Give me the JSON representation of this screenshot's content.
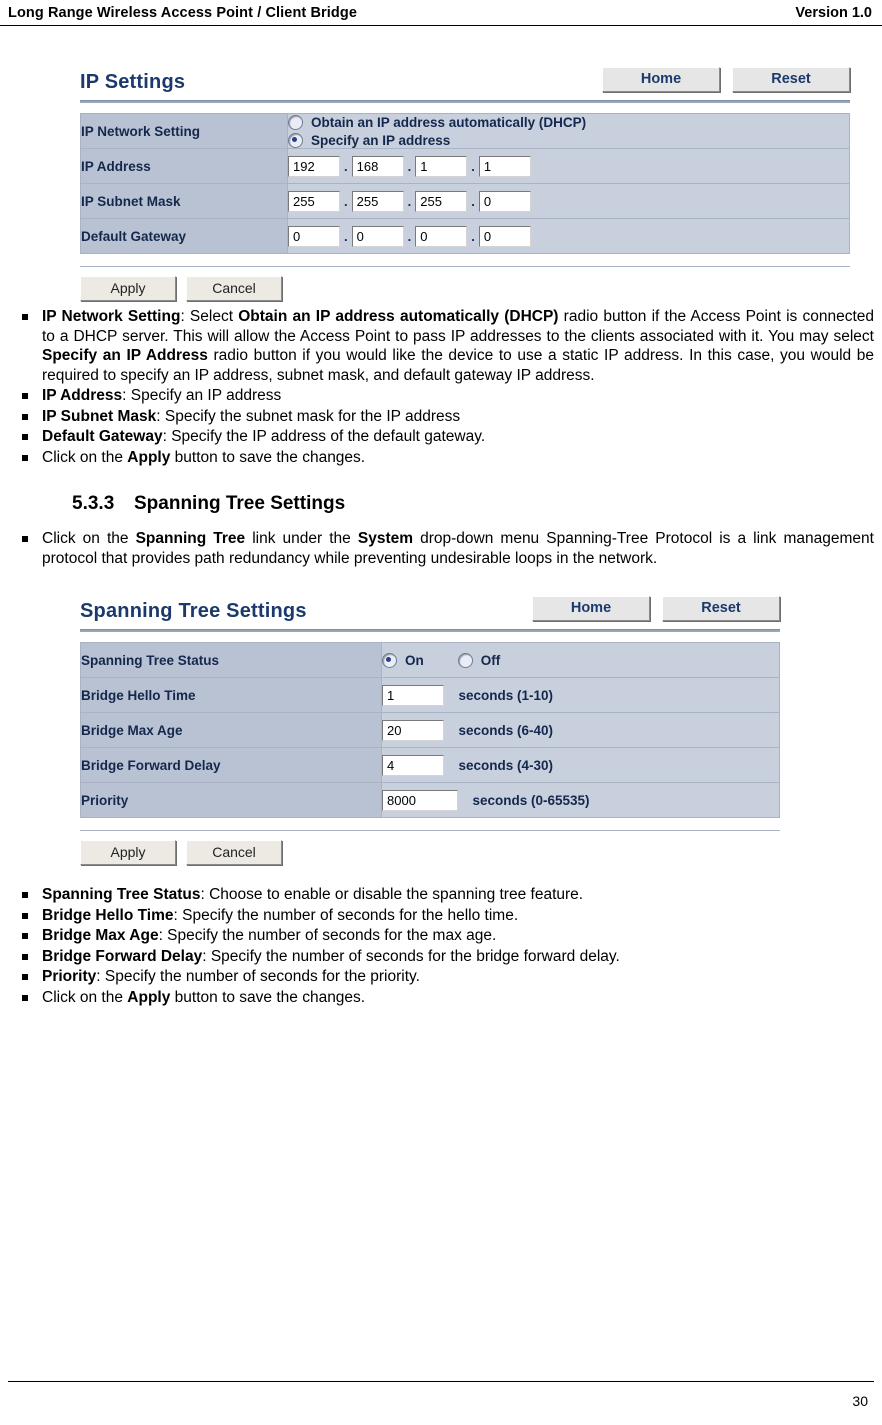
{
  "header": {
    "left": "Long Range Wireless Access Point / Client Bridge",
    "right": "Version 1.0"
  },
  "ip_settings_panel": {
    "title": "IP Settings",
    "home_button": "Home",
    "reset_button": "Reset",
    "rows": [
      {
        "label": "IP Network Setting",
        "type": "radio",
        "options": [
          {
            "label": "Obtain an IP address automatically (DHCP)",
            "selected": false
          },
          {
            "label": "Specify an IP address",
            "selected": true
          }
        ]
      },
      {
        "label": "IP Address",
        "type": "ip",
        "octets": [
          "192",
          "168",
          "1",
          "1"
        ]
      },
      {
        "label": "IP Subnet Mask",
        "type": "ip",
        "octets": [
          "255",
          "255",
          "255",
          "0"
        ]
      },
      {
        "label": "Default Gateway",
        "type": "ip",
        "octets": [
          "0",
          "0",
          "0",
          "0"
        ]
      }
    ],
    "apply_button": "Apply",
    "cancel_button": "Cancel"
  },
  "ip_bullets": [
    {
      "parts": [
        {
          "t": "IP Network Setting",
          "b": true
        },
        {
          "t": ": Select ",
          "b": false
        },
        {
          "t": "Obtain an IP address automatically (DHCP)",
          "b": true
        },
        {
          "t": " radio button if the Access Point is connected to a DHCP server. This will allow the Access Point to pass IP addresses to the clients associated with it. You may select ",
          "b": false
        },
        {
          "t": "Specify an IP Address",
          "b": true
        },
        {
          "t": " radio button if you would like the device to use a static IP address. In this case, you would be required to specify an IP address, subnet mask, and default gateway IP address.",
          "b": false
        }
      ]
    },
    {
      "parts": [
        {
          "t": "IP Address",
          "b": true
        },
        {
          "t": ": Specify an IP address",
          "b": false
        }
      ]
    },
    {
      "parts": [
        {
          "t": "IP Subnet Mask",
          "b": true
        },
        {
          "t": ": Specify the subnet mask for the IP address",
          "b": false
        }
      ]
    },
    {
      "parts": [
        {
          "t": "Default Gateway",
          "b": true
        },
        {
          "t": ": Specify the IP address of the default gateway.",
          "b": false
        }
      ]
    },
    {
      "parts": [
        {
          "t": "Click on the ",
          "b": false
        },
        {
          "t": "Apply",
          "b": true
        },
        {
          "t": " button to save the changes.",
          "b": false
        }
      ]
    }
  ],
  "section": {
    "number": "5.3.3",
    "title": "Spanning Tree Settings"
  },
  "section_bullets": [
    {
      "parts": [
        {
          "t": "Click on the ",
          "b": false
        },
        {
          "t": "Spanning Tree",
          "b": true
        },
        {
          "t": " link under the ",
          "b": false
        },
        {
          "t": "System",
          "b": true
        },
        {
          "t": " drop-down menu Spanning-Tree Protocol is a link management protocol that provides path redundancy while preventing undesirable loops in the network.",
          "b": false
        }
      ]
    }
  ],
  "spanning_tree_panel": {
    "title": "Spanning Tree Settings",
    "home_button": "Home",
    "reset_button": "Reset",
    "rows": [
      {
        "label": "Spanning Tree Status",
        "type": "radio",
        "options": [
          {
            "label": "On",
            "selected": true
          },
          {
            "label": "Off",
            "selected": false
          }
        ]
      },
      {
        "label": "Bridge Hello Time",
        "type": "text",
        "value": "1",
        "unit": "seconds (1-10)"
      },
      {
        "label": "Bridge Max Age",
        "type": "text",
        "value": "20",
        "unit": "seconds (6-40)"
      },
      {
        "label": "Bridge Forward Delay",
        "type": "text",
        "value": "4",
        "unit": "seconds (4-30)"
      },
      {
        "label": "Priority",
        "type": "text",
        "value": "8000",
        "unit": "seconds (0-65535)"
      }
    ],
    "apply_button": "Apply",
    "cancel_button": "Cancel"
  },
  "st_bullets": [
    {
      "parts": [
        {
          "t": "Spanning Tree Status",
          "b": true
        },
        {
          "t": ": Choose to enable or disable the spanning tree feature.",
          "b": false
        }
      ]
    },
    {
      "parts": [
        {
          "t": "Bridge Hello Time",
          "b": true
        },
        {
          "t": ": Specify the number of seconds for the hello time.",
          "b": false
        }
      ]
    },
    {
      "parts": [
        {
          "t": "Bridge Max Age",
          "b": true
        },
        {
          "t": ": Specify the number of seconds for the max age.",
          "b": false
        }
      ]
    },
    {
      "parts": [
        {
          "t": "Bridge Forward Delay",
          "b": true
        },
        {
          "t": ": Specify the number of seconds for the bridge forward delay.",
          "b": false
        }
      ]
    },
    {
      "parts": [
        {
          "t": "Priority",
          "b": true
        },
        {
          "t": ": Specify the number of seconds for the priority.",
          "b": false
        }
      ]
    },
    {
      "parts": [
        {
          "t": "Click on the ",
          "b": false
        },
        {
          "t": "Apply",
          "b": true
        },
        {
          "t": " button to save the changes.",
          "b": false
        }
      ]
    }
  ],
  "footer": {
    "page_number": "30"
  }
}
